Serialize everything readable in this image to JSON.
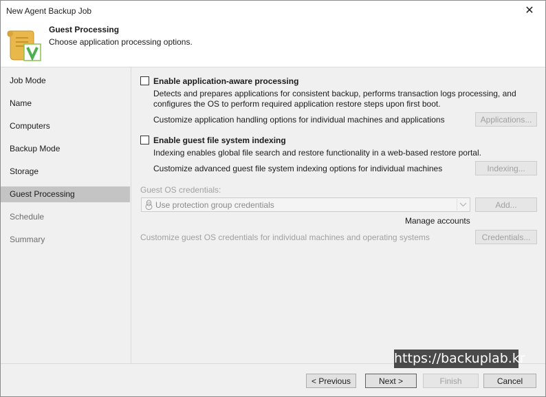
{
  "window": {
    "title": "New Agent Backup Job",
    "close_glyph": "✕"
  },
  "header": {
    "title": "Guest Processing",
    "subtitle": "Choose application processing options.",
    "icon": "scroll-checkmark-icon"
  },
  "sidebar": {
    "items": [
      {
        "label": "Job Mode",
        "state": "normal"
      },
      {
        "label": "Name",
        "state": "normal"
      },
      {
        "label": "Computers",
        "state": "normal"
      },
      {
        "label": "Backup Mode",
        "state": "normal"
      },
      {
        "label": "Storage",
        "state": "normal"
      },
      {
        "label": "Guest Processing",
        "state": "active"
      },
      {
        "label": "Schedule",
        "state": "disabled"
      },
      {
        "label": "Summary",
        "state": "disabled"
      }
    ]
  },
  "app_aware": {
    "label": "Enable application-aware processing",
    "checked": false,
    "desc_line1": "Detects and prepares applications for consistent backup, performs transaction logs processing, and",
    "desc_line2": "configures the OS to perform required application restore steps upon first boot.",
    "customize": "Customize application handling options for individual machines and applications",
    "button": "Applications..."
  },
  "indexing": {
    "label": "Enable guest file system indexing",
    "checked": false,
    "desc": "Indexing enables global file search and restore functionality in a web-based restore portal.",
    "customize": "Customize advanced guest file system indexing options for individual machines",
    "button": "Indexing..."
  },
  "credentials": {
    "label": "Guest OS credentials:",
    "selected": "Use protection group credentials",
    "add_button": "Add...",
    "manage_link": "Manage accounts",
    "customize": "Customize guest OS credentials for individual machines and operating systems",
    "button": "Credentials...",
    "combo_icon": "linux-penguin-icon"
  },
  "footer": {
    "previous": "< Previous",
    "next": "Next >",
    "finish": "Finish",
    "cancel": "Cancel"
  },
  "watermark": "https://backuplab.kr",
  "colors": {
    "accent": "#0078d7",
    "active_nav": "#c4c4c4",
    "panel": "#f0f0f0",
    "scroll_yellow": "#e8b84a",
    "check_green": "#4caf50"
  }
}
